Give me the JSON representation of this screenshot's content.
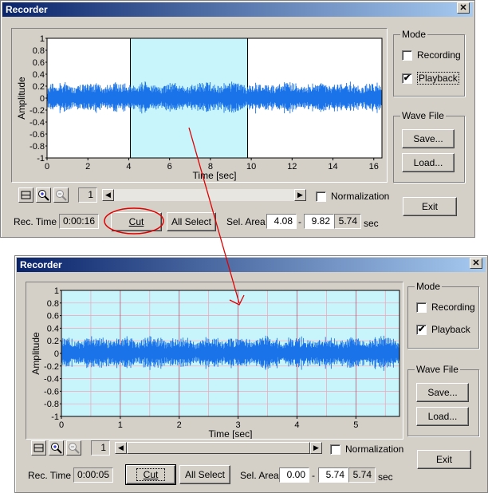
{
  "window_title": "Recorder",
  "close_glyph": "✕",
  "chart_data": [
    {
      "type": "area",
      "ylabel": "Amplitude",
      "xlabel": "Time [sec]",
      "xlim": [
        0,
        16.4
      ],
      "ylim": [
        -1,
        1
      ],
      "xticks": [
        "0",
        "2",
        "4",
        "6",
        "8",
        "10",
        "12",
        "14",
        "16"
      ],
      "yticks": [
        "1",
        "0.8",
        "0.6",
        "0.4",
        "0.2",
        "0",
        "-0.2",
        "-0.4",
        "-0.6",
        "-0.8",
        "-1"
      ],
      "selection": [
        4.08,
        9.82
      ],
      "grid": false
    },
    {
      "type": "area",
      "ylabel": "Amplitude",
      "xlabel": "Time [sec]",
      "xlim": [
        0,
        5.74
      ],
      "ylim": [
        -1,
        1
      ],
      "xticks": [
        "0",
        "1",
        "2",
        "3",
        "4",
        "5"
      ],
      "yticks": [
        "1",
        "0.8",
        "0.6",
        "0.4",
        "0.2",
        "0",
        "-0.2",
        "-0.4",
        "-0.6",
        "-0.8",
        "-1"
      ],
      "selection": [
        0.0,
        5.74
      ],
      "grid": true
    }
  ],
  "top": {
    "mode_label": "Mode",
    "recording_label": "Recording",
    "playback_label": "Playback",
    "wavefile_label": "Wave File",
    "save_label": "Save...",
    "load_label": "Load...",
    "exit_label": "Exit",
    "zoom_value": "1",
    "normalization_label": "Normalization",
    "rec_time_label": "Rec. Time",
    "rec_time_value": "0:00:16",
    "cut_label": "Cut",
    "all_select_label": "All Select",
    "sel_area_label": "Sel. Area",
    "sel_start": "4.08",
    "sel_dash": "-",
    "sel_end": "9.82",
    "sel_len": "5.74",
    "sec_label": "sec"
  },
  "bottom": {
    "mode_label": "Mode",
    "recording_label": "Recording",
    "playback_label": "Playback",
    "wavefile_label": "Wave File",
    "save_label": "Save...",
    "load_label": "Load...",
    "exit_label": "Exit",
    "zoom_value": "1",
    "normalization_label": "Normalization",
    "rec_time_label": "Rec. Time",
    "rec_time_value": "0:00:05",
    "cut_label": "Cut",
    "all_select_label": "All Select",
    "sel_area_label": "Sel. Area",
    "sel_start": "0.00",
    "sel_dash": "-",
    "sel_end": "5.74",
    "sel_len": "5.74",
    "sec_label": "sec"
  },
  "checked_glyph": "✔",
  "colors": {
    "waveform": "#1a73e8",
    "selection": "#c8f4fb",
    "grid": "#f4a0b4",
    "annotation": "#e00000",
    "titlebar": "#0a246a"
  }
}
